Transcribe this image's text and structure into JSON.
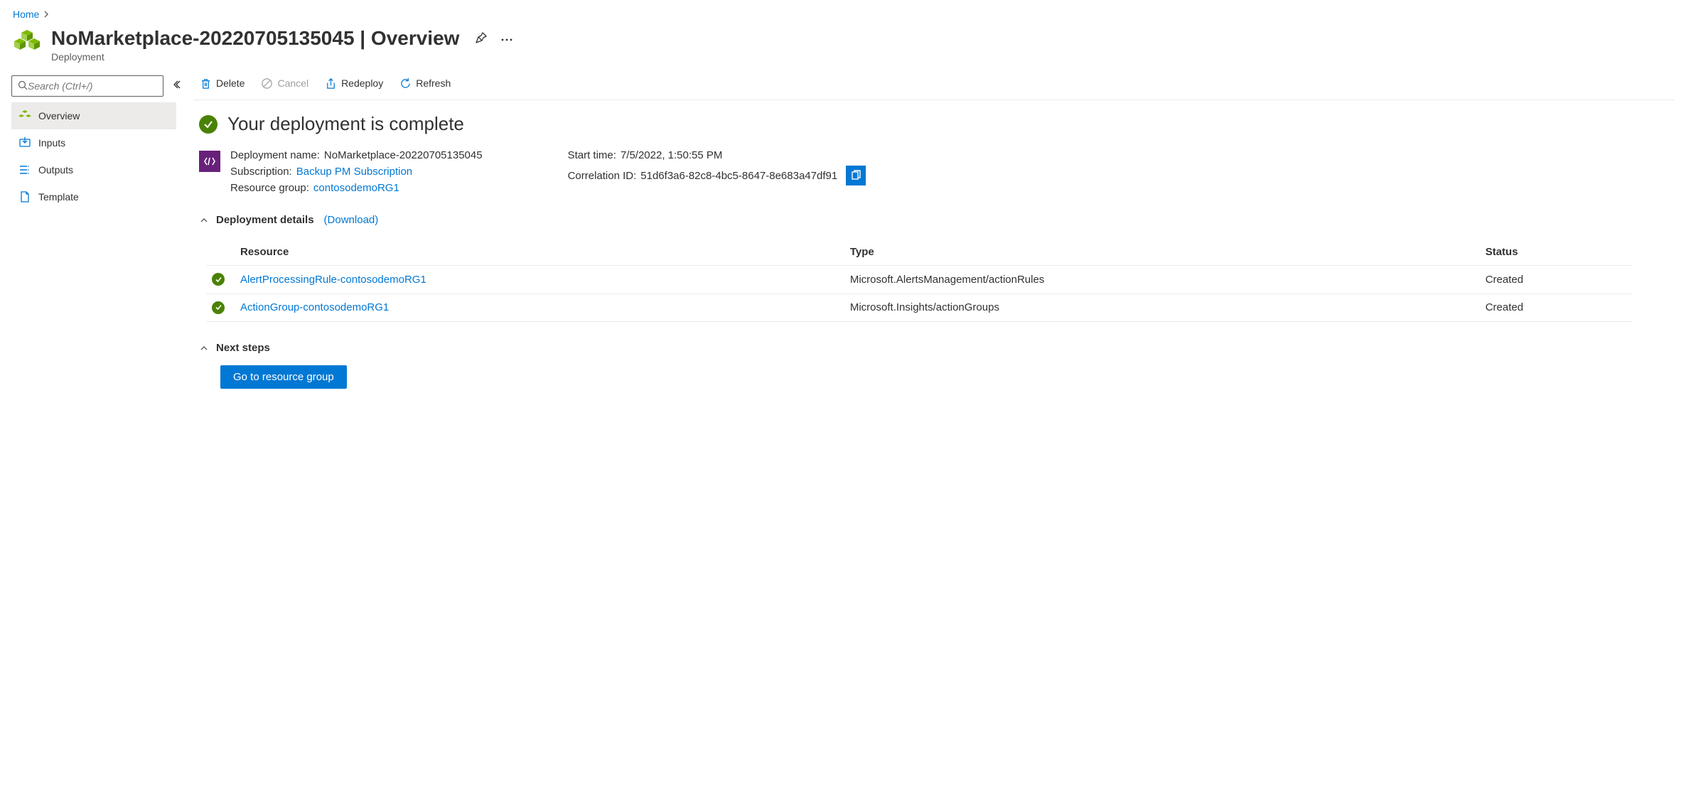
{
  "breadcrumb": {
    "home": "Home"
  },
  "header": {
    "title": "NoMarketplace-20220705135045 | Overview",
    "subtitle": "Deployment"
  },
  "sidebar": {
    "search_placeholder": "Search (Ctrl+/)",
    "items": [
      {
        "label": "Overview"
      },
      {
        "label": "Inputs"
      },
      {
        "label": "Outputs"
      },
      {
        "label": "Template"
      }
    ]
  },
  "toolbar": {
    "delete": "Delete",
    "cancel": "Cancel",
    "redeploy": "Redeploy",
    "refresh": "Refresh"
  },
  "status": {
    "heading": "Your deployment is complete",
    "deployment_name_label": "Deployment name:",
    "deployment_name": "NoMarketplace-20220705135045",
    "subscription_label": "Subscription:",
    "subscription": "Backup PM Subscription",
    "resource_group_label": "Resource group:",
    "resource_group": "contosodemoRG1",
    "start_time_label": "Start time:",
    "start_time": "7/5/2022, 1:50:55 PM",
    "correlation_label": "Correlation ID:",
    "correlation_id": "51d6f3a6-82c8-4bc5-8647-8e683a47df91"
  },
  "deployment_details": {
    "title": "Deployment details",
    "download": "(Download)",
    "columns": {
      "resource": "Resource",
      "type": "Type",
      "status": "Status"
    },
    "rows": [
      {
        "resource": "AlertProcessingRule-contosodemoRG1",
        "type": "Microsoft.AlertsManagement/actionRules",
        "status": "Created"
      },
      {
        "resource": "ActionGroup-contosodemoRG1",
        "type": "Microsoft.Insights/actionGroups",
        "status": "Created"
      }
    ]
  },
  "next_steps": {
    "title": "Next steps",
    "go_button": "Go to resource group"
  }
}
